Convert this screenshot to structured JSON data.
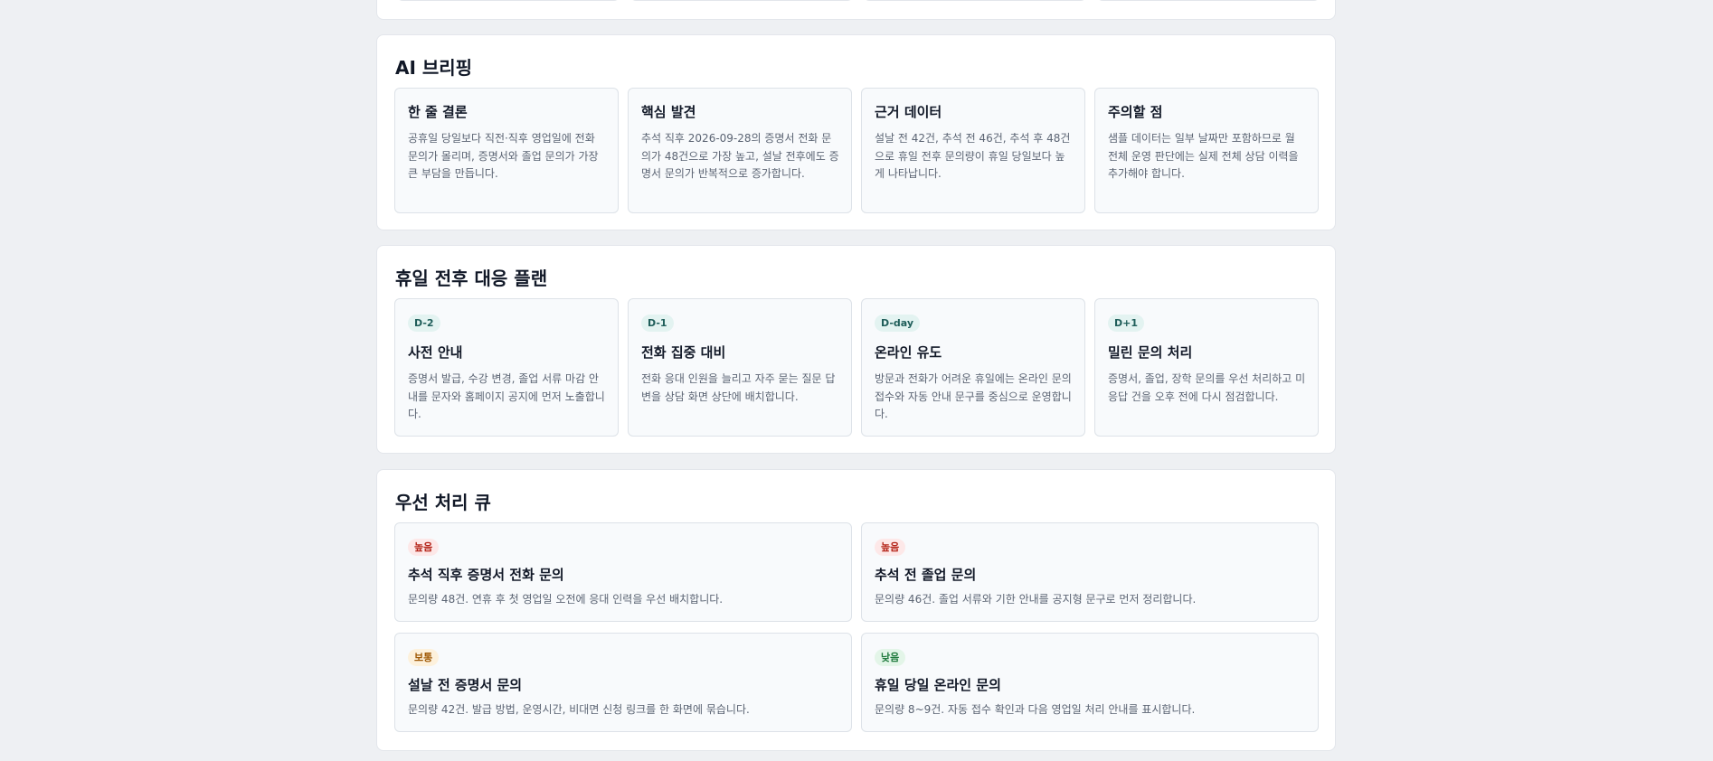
{
  "briefing": {
    "title": "AI 브리핑",
    "cards": [
      {
        "title": "한 줄 결론",
        "body": "공휴일 당일보다 직전·직후 영업일에 전화 문의가 몰리며, 증명서와 졸업 문의가 가장 큰 부담을 만듭니다."
      },
      {
        "title": "핵심 발견",
        "body": "추석 직후 2026-09-28의 증명서 전화 문의가 48건으로 가장 높고, 설날 전후에도 증명서 문의가 반복적으로 증가합니다."
      },
      {
        "title": "근거 데이터",
        "body": "설날 전 42건, 추석 전 46건, 추석 후 48건으로 휴일 전후 문의량이 휴일 당일보다 높게 나타납니다."
      },
      {
        "title": "주의할 점",
        "body": "샘플 데이터는 일부 날짜만 포함하므로 월 전체 운영 판단에는 실제 전체 상담 이력을 추가해야 합니다."
      }
    ]
  },
  "plan": {
    "title": "휴일 전후 대응 플랜",
    "cards": [
      {
        "badge": "D-2",
        "title": "사전 안내",
        "body": "증명서 발급, 수강 변경, 졸업 서류 마감 안내를 문자와 홈페이지 공지에 먼저 노출합니다."
      },
      {
        "badge": "D-1",
        "title": "전화 집중 대비",
        "body": "전화 응대 인원을 늘리고 자주 묻는 질문 답변을 상담 화면 상단에 배치합니다."
      },
      {
        "badge": "D-day",
        "title": "온라인 유도",
        "body": "방문과 전화가 어려운 휴일에는 온라인 문의 접수와 자동 안내 문구를 중심으로 운영합니다."
      },
      {
        "badge": "D+1",
        "title": "밀린 문의 처리",
        "body": "증명서, 졸업, 장학 문의를 우선 처리하고 미응답 건을 오후 전에 다시 점검합니다."
      }
    ]
  },
  "queue": {
    "title": "우선 처리 큐",
    "items": [
      {
        "priority": "높음",
        "level": "high",
        "title": "추석 직후 증명서 전화 문의",
        "body": "문의량 48건. 연휴 후 첫 영업일 오전에 응대 인력을 우선 배치합니다."
      },
      {
        "priority": "높음",
        "level": "high",
        "title": "추석 전 졸업 문의",
        "body": "문의량 46건. 졸업 서류와 기한 안내를 공지형 문구로 먼저 정리합니다."
      },
      {
        "priority": "보통",
        "level": "medium",
        "title": "설날 전 증명서 문의",
        "body": "문의량 42건. 발급 방법, 운영시간, 비대면 신청 링크를 한 화면에 묶습니다."
      },
      {
        "priority": "낮음",
        "level": "low",
        "title": "휴일 당일 온라인 문의",
        "body": "문의량 8~9건. 자동 접수 확인과 다음 영업일 처리 안내를 표시합니다."
      }
    ]
  },
  "colors": {
    "background": "#eef0f3",
    "panel": "#ffffff",
    "card": "#f8fafc",
    "badge_plan": "#e3f3f1",
    "priority_high": "#b42318",
    "priority_medium": "#a05a07",
    "priority_low": "#1f7a3d"
  }
}
